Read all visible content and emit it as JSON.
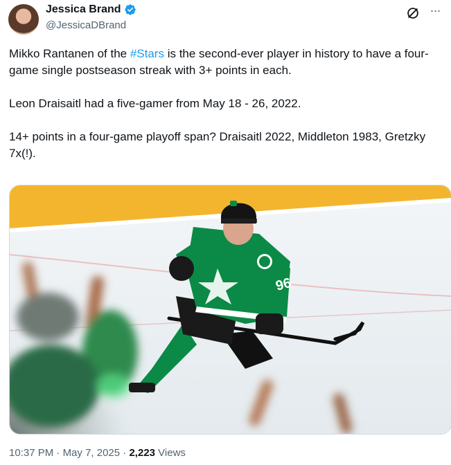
{
  "author": {
    "display_name": "Jessica Brand",
    "handle": "@JessicaDBrand",
    "verified": true
  },
  "icons": {
    "verified": "verified-badge-icon",
    "grok": "grok-icon",
    "more": "more-options-icon"
  },
  "tweet": {
    "line1_pre": "Mikko Rantanen of the ",
    "hashtag": "#Stars",
    "line1_post": " is the second-ever player in history to have a four-game single postseason streak with 3+ points in each.",
    "para2": "Leon Draisaitl had a five-gamer from May 18 - 26, 2022.",
    "para3": "14+ points in a four-game playoff span? Draisaitl 2022, Middleton 1983, Gretzky 7x(!)."
  },
  "media": {
    "jersey_number": "96"
  },
  "meta": {
    "time": "10:37 PM",
    "separator": " · ",
    "date": "May 7, 2025",
    "views_count": "2,223",
    "views_label": " Views"
  },
  "colors": {
    "accent": "#1d9bf0",
    "stars_green": "#0a8a46",
    "text_secondary": "#536471"
  }
}
